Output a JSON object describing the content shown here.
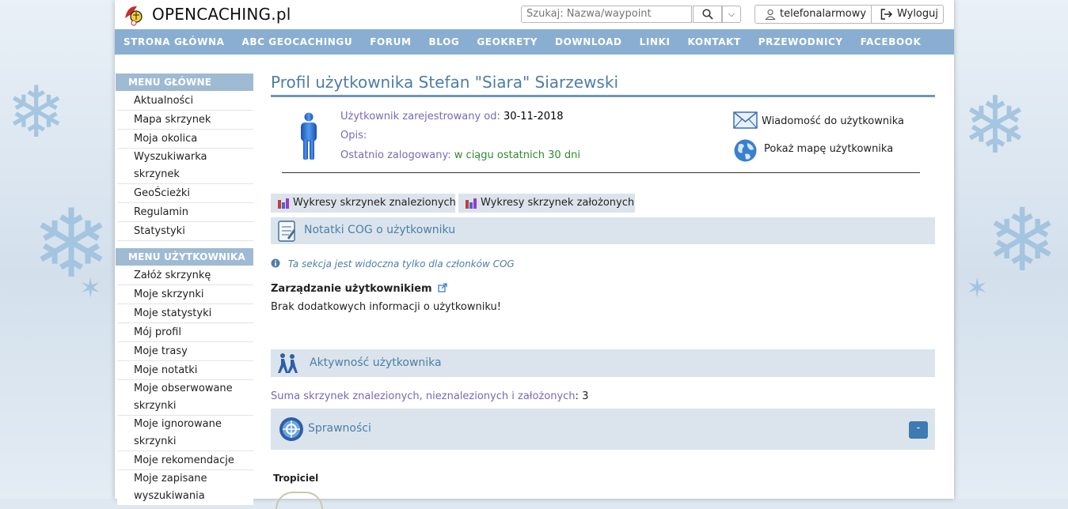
{
  "header": {
    "logo_text": "OPENCACHING.pl",
    "search_placeholder": "Szukaj: Nazwa/waypoint",
    "username": "telefonalarmowy",
    "logout_label": "Wyloguj"
  },
  "nav": [
    "STRONA GŁÓWNA",
    "ABC GEOCACHINGU",
    "FORUM",
    "BLOG",
    "GEOKRETY",
    "DOWNLOAD",
    "LINKI",
    "KONTAKT",
    "PRZEWODNICY",
    "FACEBOOK"
  ],
  "sidebar": {
    "main_menu_title": "MENU GŁÓWNE",
    "main_menu": [
      "Aktualności",
      "Mapa skrzynek",
      "Moja okolica",
      "Wyszukiwarka skrzynek",
      "GeoŚcieżki",
      "Regulamin",
      "Statystyki"
    ],
    "user_menu_title": "MENU UŻYTKOWNIKA",
    "user_menu": [
      "Załóż skrzynkę",
      "Moje skrzynki",
      "Moje statystyki",
      "Mój profil",
      "Moje trasy",
      "Moje notatki",
      "Moje obserwowane skrzynki",
      "Moje ignorowane skrzynki",
      "Moje rekomendacje",
      "Moje zapisane wyszukiwania"
    ]
  },
  "profile": {
    "title": "Profil użytkownika Stefan \"Siara\" Siarzewski",
    "registered_label": "Użytkownik zarejestrowany od:",
    "registered_value": "30-11-2018",
    "description_label": "Opis:",
    "last_login_label": "Ostatnio zalogowany:",
    "last_login_value": "w ciągu ostatnich 30 dni",
    "message_action": "Wiadomość do użytkownika",
    "map_action": "Pokaż mapę użytkownika"
  },
  "tabs": [
    "Wykresy skrzynek znalezionych",
    "Wykresy skrzynek założonych"
  ],
  "cog": {
    "title": "Notatki COG o użytkowniku",
    "visibility_note": "Ta sekcja jest widoczna tylko dla członków COG",
    "manage_label": "Zarządzanie użytkownikiem",
    "no_info": "Brak dodatkowych informacji o użytkowniku!"
  },
  "activity": {
    "title": "Aktywność użytkownika",
    "sum_label": "Suma skrzynek znalezionych, nieznalezionych i założonych",
    "sum_value": "3"
  },
  "badges": {
    "title": "Sprawności",
    "collapse_label": "-",
    "first_badge": "Tropiciel"
  },
  "colors": {
    "nav_bg": "#8aaed1",
    "sidebar_head_bg": "#9fbad3",
    "section_bg": "#dbe4ec",
    "title_color": "#4c7ea6",
    "label_color": "#7a68b4",
    "green_text": "#2e8b2e"
  }
}
